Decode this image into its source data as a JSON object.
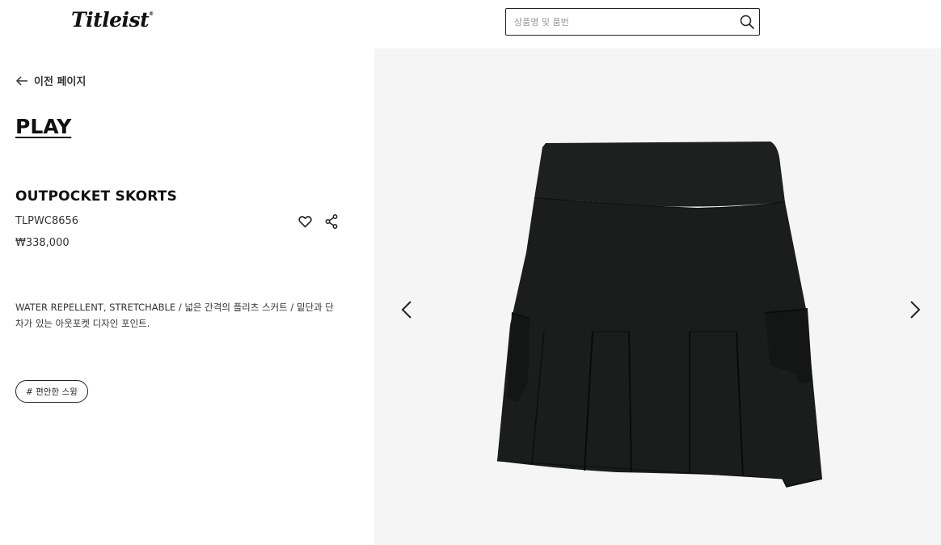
{
  "header": {
    "logo_text": "Titleist",
    "logo_mark": "®",
    "search_placeholder": "상품명 및 품번",
    "search_icon": "search-icon"
  },
  "nav": {
    "back_label": "이전 페이지",
    "back_icon": "arrow-left-icon"
  },
  "product": {
    "collection": "PLAY",
    "name": "OUTPOCKET SKORTS",
    "code": "TLPWC8656",
    "price": "₩338,000",
    "description": "WATER REPELLENT, STRETCHABLE / 넓은 간격의 플리츠 스커트 / 밑단과 단차가 있는 아웃포켓 디자인 포인트.",
    "tag": "# 편안한 스윙",
    "wish_icon": "heart-icon",
    "share_icon": "share-icon"
  },
  "gallery": {
    "prev_icon": "chevron-left-icon",
    "next_icon": "chevron-right-icon",
    "image": "black-pleated-skort",
    "background": "#f5f5f5",
    "product_color": "#1b1c1c"
  }
}
